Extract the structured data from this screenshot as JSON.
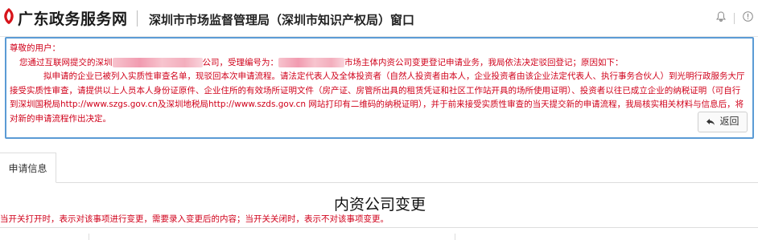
{
  "header": {
    "brand": "广东政务服务网",
    "bureau": "深圳市市场监督管理局（深圳市知识产权局）窗口"
  },
  "notice": {
    "greeting": "尊敬的用户：",
    "line1_part1": "您通过互联网提交的深圳",
    "line1_part2": "公司，受理编号为：",
    "line1_part3": "市场主体内资公司变更登记申请业务，我局依法决定驳回登记；原因如下：",
    "body": "拟申请的企业已被列入实质性审查名单，现驳回本次申请流程。请法定代表人及全体投资者（自然人投资者由本人，企业投资者由该企业法定代表人、执行事务合伙人）到光明行政服务大厅接受实质性审查，请提供以上人员本人身份证原件、企业住所的有效场所证明文件（房产证、房管所出具的租赁凭证和社区工作站开具的场所使用证明）、投资者以往已成立企业的纳税证明（可自行到深圳国税局http://www.szgs.gov.cn及深圳地税局http://www.szds.gov.cn 网站打印有二维码的纳税证明），并于前来接受实质性审查的当天提交新的申请流程，我局核实相关材料与信息后，将对新的申请流程作出决定。",
    "back_label": "返回"
  },
  "tabs": [
    {
      "label": "申请信息"
    }
  ],
  "form": {
    "title": "内资公司变更",
    "hint": "当开关打开时，表示对该事项进行变更，需要录入变更后的内容；当开关关闭时，表示不对该事项变更。"
  },
  "icons": {
    "bell": "bell-icon",
    "user": "user-icon",
    "back": "reply-arrow-icon",
    "logo": "guangdong-logo"
  },
  "colors": {
    "notice_text": "#d0021b",
    "notice_border": "#5b9bd5",
    "brand_logo": "#d7141a"
  }
}
